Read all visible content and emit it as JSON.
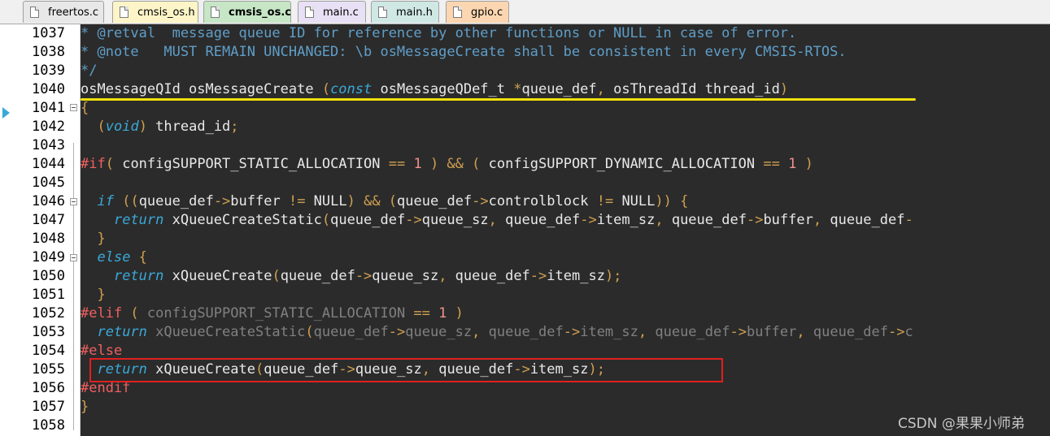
{
  "tabs": [
    {
      "label": "freertos.c",
      "color": "#e8e8e8",
      "active": false
    },
    {
      "label": "cmsis_os.h",
      "color": "#fdf5c8",
      "active": false
    },
    {
      "label": "cmsis_os.c",
      "color": "#c6e6c6",
      "active": true
    },
    {
      "label": "main.c",
      "color": "#e8e0f4",
      "active": false
    },
    {
      "label": "main.h",
      "color": "#cfe8e4",
      "active": false
    },
    {
      "label": "gpio.c",
      "color": "#fbd6b0",
      "active": false
    }
  ],
  "line_numbers": [
    "1037",
    "1038",
    "1039",
    "1040",
    "1041",
    "1042",
    "1043",
    "1044",
    "1045",
    "1046",
    "1047",
    "1048",
    "1049",
    "1050",
    "1051",
    "1052",
    "1053",
    "1054",
    "1055",
    "1056",
    "1057",
    "1058"
  ],
  "code": {
    "l1037": {
      "p1": "* @retval  message queue ID for reference by other functions or NULL in case of error."
    },
    "l1038": {
      "p1": "* @note   MUST REMAIN UNCHANGED: \\b osMessageCreate shall be consistent in every CMSIS-RTOS."
    },
    "l1039": {
      "p1": "*/"
    },
    "l1040": {
      "p1": "osMessageQId osMessageCreate ",
      "p2": "(",
      "p3": "const",
      "p4": " osMessageQDef_t ",
      "p5": "*",
      "p6": "queue_def",
      "p7": ",",
      "p8": " osThreadId thread_id",
      "p9": ")"
    },
    "l1041": {
      "p1": "{"
    },
    "l1042": {
      "p1": "  ",
      "p2": "(",
      "p3": "void",
      "p4": ")",
      "p5": " thread_id",
      "p6": ";"
    },
    "l1044": {
      "p1": "#if",
      "p2": "(",
      "p3": " configSUPPORT_STATIC_ALLOCATION ",
      "p4": "==",
      "p5": " ",
      "p6": "1",
      "p7": " ) && ( ",
      "p8": "configSUPPORT_DYNAMIC_ALLOCATION ",
      "p9": "==",
      "p10": " ",
      "p11": "1",
      "p12": " )"
    },
    "l1046": {
      "p1": "  ",
      "p2": "if",
      "p3": " ((",
      "p4": "queue_def",
      "p5": "->",
      "p6": "buffer ",
      "p7": "!=",
      "p8": " NULL",
      "p9": ") && (",
      "p10": "queue_def",
      "p11": "->",
      "p12": "controlblock ",
      "p13": "!=",
      "p14": " NULL",
      "p15": ")) {"
    },
    "l1047": {
      "p1": "    ",
      "p2": "return",
      "p3": " xQueueCreateStatic",
      "p4": "(",
      "p5": "queue_def",
      "p6": "->",
      "p7": "queue_sz",
      "p8": ", ",
      "p9": "queue_def",
      "p10": "->",
      "p11": "item_sz",
      "p12": ", ",
      "p13": "queue_def",
      "p14": "->",
      "p15": "buffer",
      "p16": ", ",
      "p17": "queue_def",
      "p18": "-"
    },
    "l1048": {
      "p1": "  }"
    },
    "l1049": {
      "p1": "  ",
      "p2": "else",
      "p3": " {"
    },
    "l1050": {
      "p1": "    ",
      "p2": "return",
      "p3": " xQueueCreate",
      "p4": "(",
      "p5": "queue_def",
      "p6": "->",
      "p7": "queue_sz",
      "p8": ", ",
      "p9": "queue_def",
      "p10": "->",
      "p11": "item_sz",
      "p12": ");"
    },
    "l1051": {
      "p1": "  }"
    },
    "l1052": {
      "p1": "#elif",
      "p2": " ( ",
      "p3": "configSUPPORT_STATIC_ALLOCATION ",
      "p4": "==",
      "p5": " ",
      "p6": "1",
      "p7": " )"
    },
    "l1053": {
      "p1": "  ",
      "p2": "return",
      "p3": " xQueueCreateStatic",
      "p4": "(",
      "p5": "queue_def",
      "p6": "->",
      "p7": "queue_sz",
      "p8": ", ",
      "p9": "queue_def",
      "p10": "->",
      "p11": "item_sz",
      "p12": ", ",
      "p13": "queue_def",
      "p14": "->",
      "p15": "buffer",
      "p16": ", ",
      "p17": "queue_def",
      "p18": "->",
      "p19": "c"
    },
    "l1054": {
      "p1": "#else"
    },
    "l1055": {
      "p1": "  ",
      "p2": "return",
      "p3": " xQueueCreate",
      "p4": "(",
      "p5": "queue_def",
      "p6": "->",
      "p7": "queue_sz",
      "p8": ", ",
      "p9": "queue_def",
      "p10": "->",
      "p11": "item_sz",
      "p12": ");"
    },
    "l1056": {
      "p1": "#endif"
    },
    "l1057": {
      "p1": "}"
    }
  },
  "watermark": "CSDN @果果小师弟"
}
